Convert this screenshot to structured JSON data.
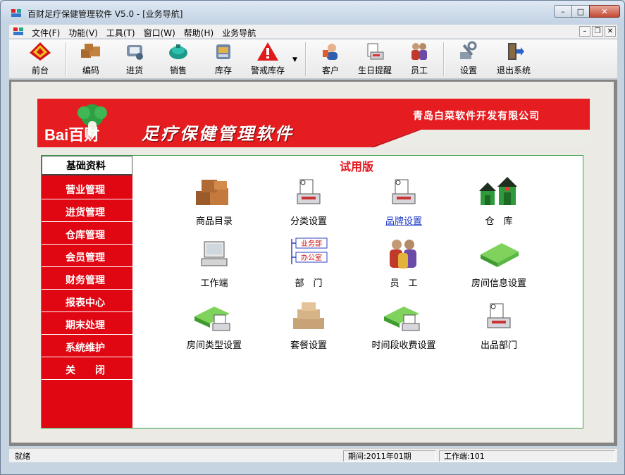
{
  "window": {
    "title": "百财足疗保健管理软件 V5.0 - [业务导航]",
    "caption": {
      "minimize": "–",
      "maximize": "□",
      "close": "✕"
    }
  },
  "menu": {
    "items": [
      "文件(F)",
      "功能(V)",
      "工具(T)",
      "窗口(W)",
      "帮助(H)",
      "业务导航"
    ],
    "mdi_buttons": [
      "–",
      "❐",
      "✕"
    ]
  },
  "toolbar": {
    "buttons": [
      {
        "label": "前台",
        "icon": "front-desk-icon"
      },
      {
        "label": "编码",
        "icon": "boxes-icon"
      },
      {
        "label": "进货",
        "icon": "purchase-icon"
      },
      {
        "label": "销售",
        "icon": "sales-icon"
      },
      {
        "label": "库存",
        "icon": "inventory-icon"
      },
      {
        "label": "警戒库存",
        "icon": "warning-icon"
      },
      {
        "label": "客户",
        "icon": "customer-icon"
      },
      {
        "label": "生日提醒",
        "icon": "birthday-icon"
      },
      {
        "label": "员工",
        "icon": "staff-icon"
      },
      {
        "label": "设置",
        "icon": "settings-icon"
      },
      {
        "label": "退出系统",
        "icon": "exit-icon"
      }
    ],
    "dropdown_glyph": "▼"
  },
  "banner": {
    "logo_text": "Bai百财",
    "title": "足疗保健管理软件",
    "company": "青岛白菜软件开发有限公司"
  },
  "sidebar": {
    "items": [
      {
        "label": "基础资料",
        "active": true
      },
      {
        "label": "营业管理"
      },
      {
        "label": "进货管理"
      },
      {
        "label": "仓库管理"
      },
      {
        "label": "会员管理"
      },
      {
        "label": "财务管理"
      },
      {
        "label": "报表中心"
      },
      {
        "label": "期末处理"
      },
      {
        "label": "系统维护"
      },
      {
        "label": "关　　闭"
      }
    ]
  },
  "main": {
    "trial_label": "试用版",
    "tiles": [
      {
        "label": "商品目录",
        "icon": "boxes-icon"
      },
      {
        "label": "分类设置",
        "icon": "printer-doc-icon"
      },
      {
        "label": "品牌设置",
        "icon": "printer-doc-icon",
        "link": true
      },
      {
        "label": "仓　库",
        "icon": "warehouse-icon"
      },
      {
        "label": "工作端",
        "icon": "computer-icon"
      },
      {
        "label": "部　门",
        "icon": "department-icon",
        "dept_tags": [
          "业务部",
          "办公室"
        ]
      },
      {
        "label": "员　工",
        "icon": "staff-icon"
      },
      {
        "label": "房间信息设置",
        "icon": "green-book-icon"
      },
      {
        "label": "房间类型设置",
        "icon": "green-book-doc-icon"
      },
      {
        "label": "套餐设置",
        "icon": "package-icon"
      },
      {
        "label": "时间段收费设置",
        "icon": "green-book-doc-icon"
      },
      {
        "label": "出品部门",
        "icon": "printer-doc-icon"
      }
    ]
  },
  "status": {
    "ready": "就绪",
    "period": "期间:2011年01期",
    "workstation": "工作端:101"
  },
  "colors": {
    "brand_red": "#e51d21",
    "sidebar_red": "#e00612",
    "trial_red": "#e5141b",
    "link_blue": "#1b39c7"
  }
}
